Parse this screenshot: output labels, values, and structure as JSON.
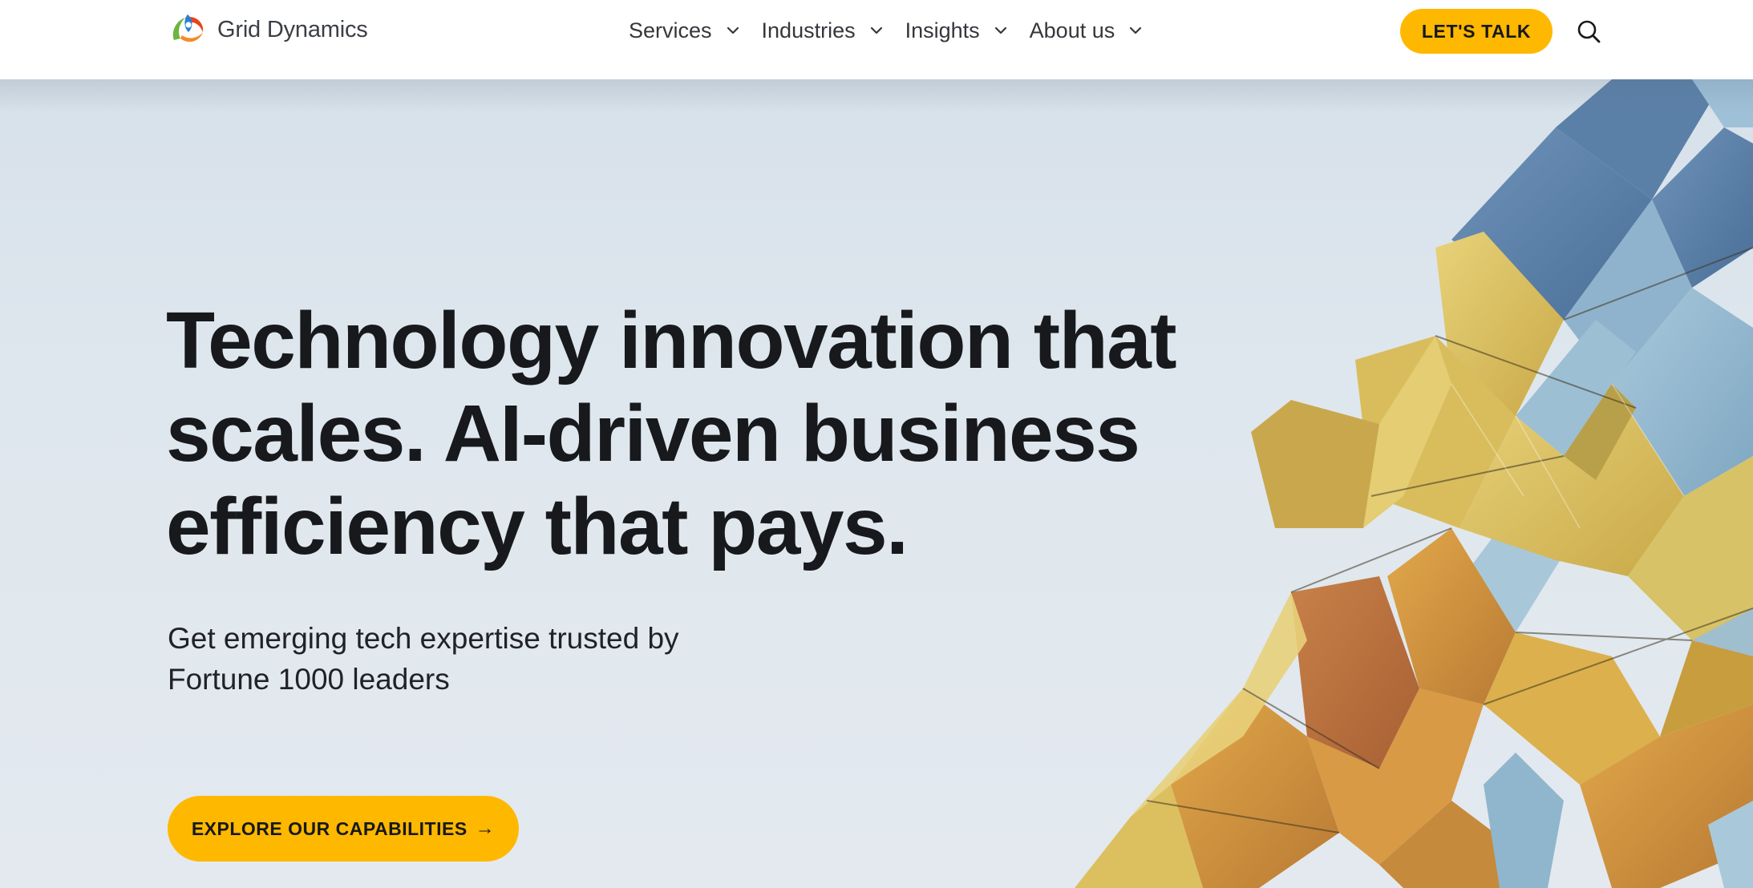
{
  "brand": {
    "name": "Grid Dynamics",
    "logo_icon": "grid-dynamics-logo-icon"
  },
  "nav": {
    "items": [
      {
        "label": "Services",
        "icon": "chevron-down-icon"
      },
      {
        "label": "Industries",
        "icon": "chevron-down-icon"
      },
      {
        "label": "Insights",
        "icon": "chevron-down-icon"
      },
      {
        "label": "About us",
        "icon": "chevron-down-icon"
      }
    ],
    "cta_label": "LET'S TALK",
    "search_icon": "search-icon"
  },
  "hero": {
    "headline_lines": [
      "Technology innovation that",
      "scales. AI-driven business",
      "efficiency that pays."
    ],
    "subtext_lines": [
      "Get emerging tech expertise trusted by",
      "Fortune 1000 leaders"
    ],
    "cta_label": "EXPLORE OUR CAPABILITIES",
    "cta_arrow": "→"
  },
  "colors": {
    "accent": "#ffb800",
    "text_dark": "#17191c",
    "hero_bg": "#dfe7ee"
  }
}
